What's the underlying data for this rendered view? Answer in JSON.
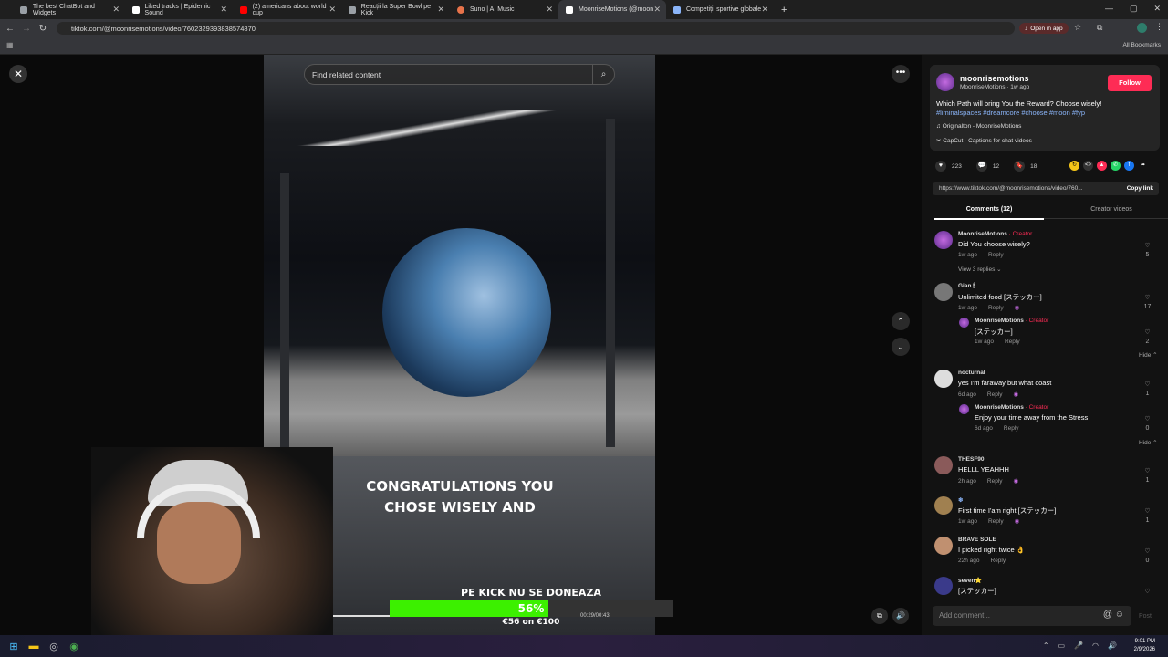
{
  "browser": {
    "tabs": [
      {
        "title": "The best ChatBot and Widgets",
        "color": "#9aa0a6"
      },
      {
        "title": "Liked tracks | Epidemic Sound",
        "color": "#ffffff"
      },
      {
        "title": "(2) americans about world cup",
        "color": "#ff0000"
      },
      {
        "title": "Reacții la Super Bowl pe Kick",
        "color": "#9aa0a6"
      },
      {
        "title": "Suno | AI Music",
        "color": "#e8734a"
      },
      {
        "title": "MoonriseMotions (@moon",
        "color": "#ffffff"
      },
      {
        "title": "Competiții sportive globale",
        "color": "#8ab4f8"
      }
    ],
    "url": "tiktok.com/@moonrisemotions/video/7602329393838574870",
    "open_in_app": "Open in app",
    "all_bookmarks": "All Bookmarks"
  },
  "video": {
    "search_placeholder": "Find related content",
    "caption_line1": "CONGRATULATIONS YOU",
    "caption_line2": "CHOSE WISELY AND",
    "timer": "00:29/00:43"
  },
  "donation": {
    "title": "PE KICK NU SE DONEAZA",
    "percent_label": "56%",
    "progress": 0.56,
    "amount": "€56 on €100",
    "color": "#3cf000"
  },
  "post": {
    "username": "moonrisemotions",
    "display_name": "MoonriseMotions",
    "time": "1w ago",
    "subline": "MoonriseMotions · 1w ago",
    "follow": "Follow",
    "description": "Which Path will bring You the Reward? Choose wisely!",
    "tags": "#liminalspaces #dreamcore #choose #moon #fyp",
    "music": "Originalton - MoonriseMotions",
    "capcut": "CapCut · Captions for chat videos",
    "likes": "223",
    "comments_count": "12",
    "saves": "18",
    "link": "https://www.tiktok.com/@moonrisemotions/video/760...",
    "copy_link": "Copy link",
    "accent": "#fe2c55"
  },
  "tabs": {
    "comments": "Comments (12)",
    "creator_videos": "Creator videos"
  },
  "comments": [
    {
      "name": "MoonriseMotions",
      "creator": " · Creator",
      "text": "Did You choose wisely?",
      "time": "1w ago",
      "reply": "Reply",
      "likes": "5",
      "reply_level": false
    },
    {
      "name": "Gian 🕯",
      "creator": "",
      "text": "Unlimited food [ステッカー]",
      "time": "1w ago",
      "reply": "Reply",
      "likes": "17",
      "reply_level": false
    },
    {
      "name": "MoonriseMotions",
      "creator": " · Creator",
      "text": "[ステッカー]",
      "time": "1w ago",
      "reply": "Reply",
      "likes": "2",
      "reply_level": true
    },
    {
      "name": "nocturnal",
      "creator": "",
      "text": "yes I'm faraway but what coast",
      "time": "6d ago",
      "reply": "Reply",
      "likes": "1",
      "reply_level": false
    },
    {
      "name": "MoonriseMotions",
      "creator": " · Creator",
      "text": "Enjoy your time away from the Stress",
      "time": "6d ago",
      "reply": "Reply",
      "likes": "0",
      "reply_level": true
    },
    {
      "name": "THESF90",
      "creator": "",
      "text": "HELLL YEAHHH",
      "time": "2h ago",
      "reply": "Reply",
      "likes": "1",
      "reply_level": false
    },
    {
      "name": "❄",
      "creator": "",
      "text": "First time I'am right [ステッカー]",
      "time": "1w ago",
      "reply": "Reply",
      "likes": "1",
      "reply_level": false
    },
    {
      "name": "BRAVE SOLE",
      "creator": "",
      "text": "I picked right twice 👌",
      "time": "22h ago",
      "reply": "Reply",
      "likes": "0",
      "reply_level": false
    },
    {
      "name": "seven⭐",
      "creator": "",
      "text": "[ステッカー]",
      "time": "",
      "reply": "",
      "likes": "",
      "reply_level": false
    }
  ],
  "view_replies": "View 3 replies ⌄",
  "hide": "Hide ⌃",
  "add_comment_placeholder": "Add comment...",
  "post_button": "Post",
  "clock": {
    "time": "9:01 PM",
    "date": "2/9/2026"
  }
}
